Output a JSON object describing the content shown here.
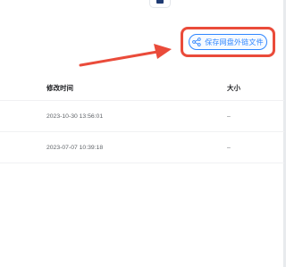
{
  "toolbar": {
    "save_label": "保存网盘外链文件"
  },
  "table": {
    "headers": {
      "modified": "修改时间",
      "size": "大小"
    },
    "rows": [
      {
        "modified": "2023-10-30 13:56:01",
        "size": "–"
      },
      {
        "modified": "2023-07-07 10:39:18",
        "size": "–"
      }
    ]
  },
  "colors": {
    "accent": "#2f86ff",
    "highlight": "#ea4b3a"
  }
}
